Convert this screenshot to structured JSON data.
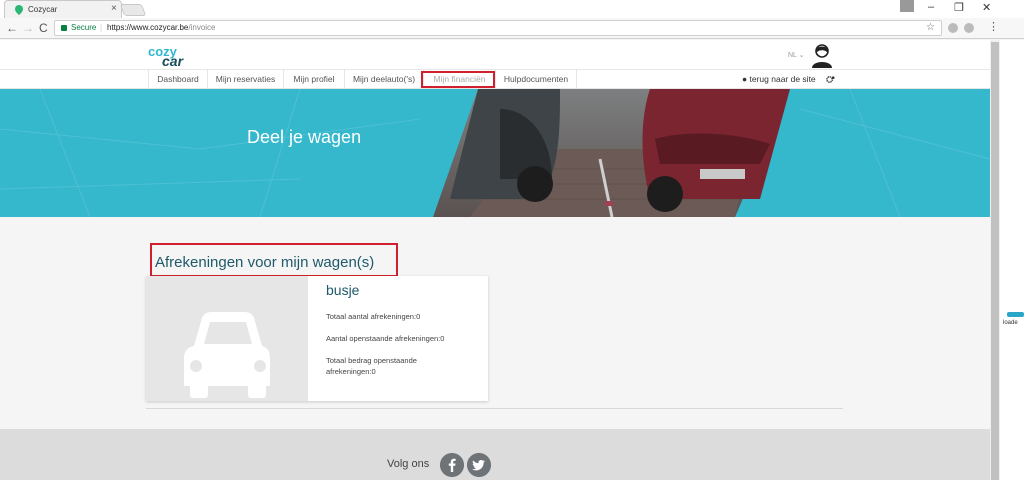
{
  "browser": {
    "tab_title": "Cozycar",
    "tab_close": "×",
    "back": "←",
    "forward": "→",
    "reload": "C",
    "secure_label": "Secure",
    "separator": "|",
    "url_prefix": "https://www.cozycar.be",
    "url_path": "/invoice",
    "star": "☆",
    "menu": "⋮",
    "minimize": "–",
    "restore": "❐",
    "close": "✕"
  },
  "site": {
    "logo_top": "cozy",
    "logo_bottom": "car",
    "language": "NL ⌄",
    "nav": [
      {
        "label": "Dashboard"
      },
      {
        "label": "Mijn reservaties"
      },
      {
        "label": "Mijn profiel"
      },
      {
        "label": "Mijn deelauto('s)"
      },
      {
        "label": "Mijn financiën"
      },
      {
        "label": "Hulpdocumenten"
      }
    ],
    "back_link": "terug naar de site"
  },
  "hero": {
    "title": "Deel je wagen"
  },
  "main": {
    "section_title": "Afrekeningen voor mijn wagen(s)",
    "car": {
      "name": "busje",
      "total_settlements": "Totaal aantal afrekeningen:0",
      "open_settlements": "Aantal openstaande afrekeningen:0",
      "open_amount": "Totaal bedrag openstaande afrekeningen:0"
    }
  },
  "footer": {
    "follow_label": "Volg ons"
  },
  "side_widget_text": "loade",
  "colors": {
    "brand_teal": "#35b7cc",
    "brand_dark": "#1e5a69",
    "highlight_red": "#d0202e"
  }
}
